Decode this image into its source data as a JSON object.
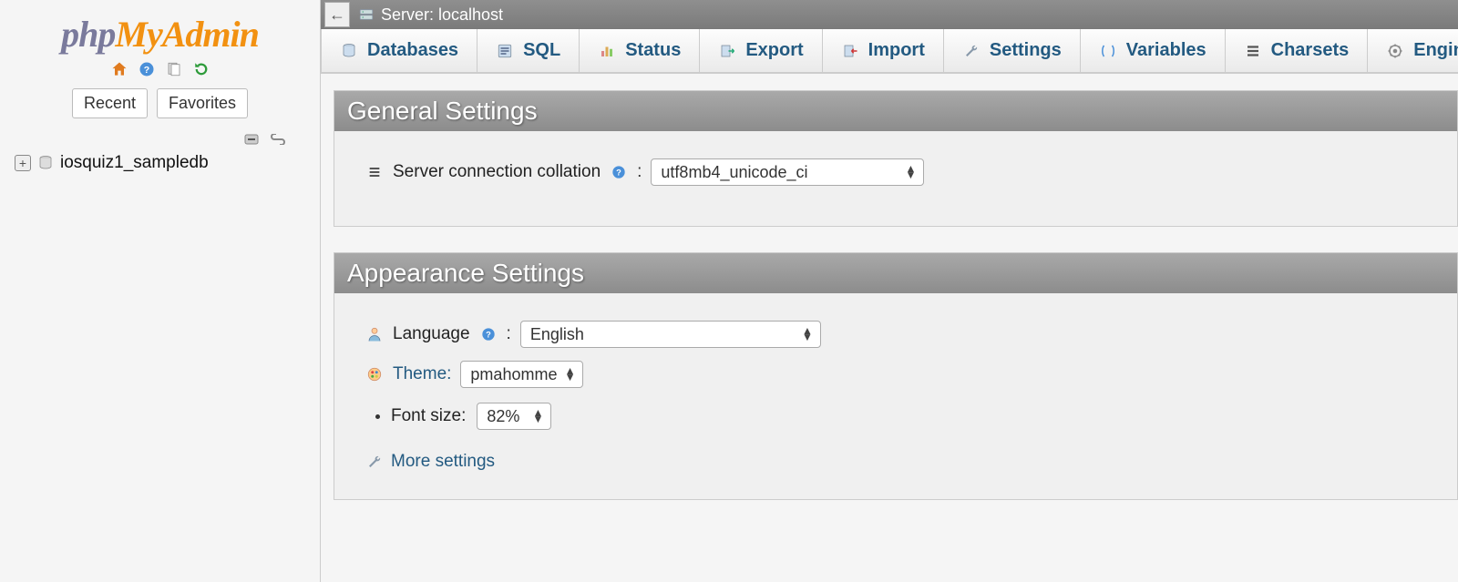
{
  "logo": {
    "part1": "php",
    "part2": "My",
    "part3": "Admin"
  },
  "sidebar": {
    "recent_label": "Recent",
    "favorites_label": "Favorites",
    "databases": [
      {
        "name": "iosquiz1_sampledb"
      }
    ]
  },
  "topbar": {
    "server_label": "Server: localhost"
  },
  "tabs": [
    {
      "id": "databases",
      "label": "Databases",
      "icon": "database"
    },
    {
      "id": "sql",
      "label": "SQL",
      "icon": "sql"
    },
    {
      "id": "status",
      "label": "Status",
      "icon": "status"
    },
    {
      "id": "export",
      "label": "Export",
      "icon": "export"
    },
    {
      "id": "import",
      "label": "Import",
      "icon": "import"
    },
    {
      "id": "settings",
      "label": "Settings",
      "icon": "wrench"
    },
    {
      "id": "variables",
      "label": "Variables",
      "icon": "variables"
    },
    {
      "id": "charsets",
      "label": "Charsets",
      "icon": "charsets"
    },
    {
      "id": "engines",
      "label": "Engines",
      "icon": "engines"
    }
  ],
  "panels": {
    "general": {
      "title": "General Settings",
      "collation_label": "Server connection collation",
      "collation_value": "utf8mb4_unicode_ci"
    },
    "appearance": {
      "title": "Appearance Settings",
      "language_label": "Language",
      "language_value": "English",
      "theme_label": "Theme:",
      "theme_value": "pmahomme",
      "fontsize_label": "Font size:",
      "fontsize_value": "82%",
      "more_settings_label": "More settings"
    }
  }
}
